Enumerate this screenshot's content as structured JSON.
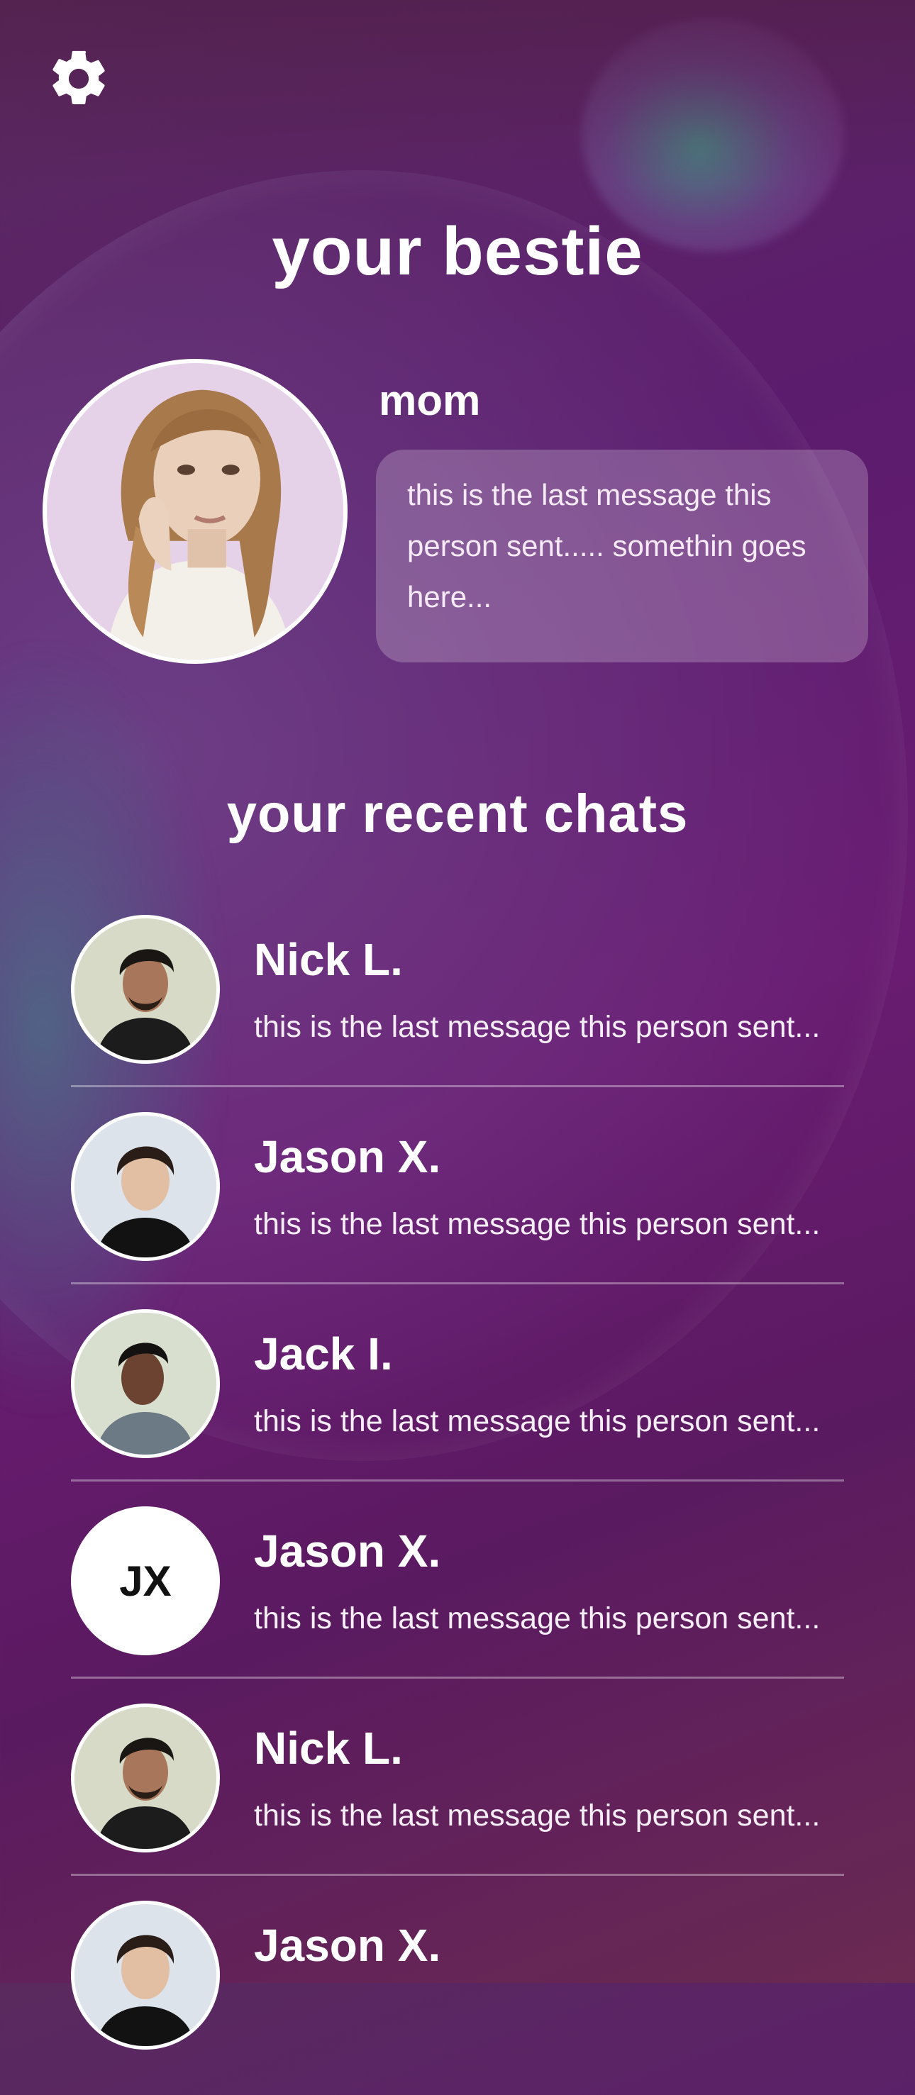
{
  "header": {
    "settings_icon": "gear-icon"
  },
  "bestie": {
    "section_title": "your bestie",
    "name": "mom",
    "last_message": "this is the last message this person sent..... somethin goes here..."
  },
  "recent": {
    "section_title": "your recent chats",
    "chats": [
      {
        "name": "Nick L.",
        "preview": "this is the last message this person sent...",
        "avatar": "photo"
      },
      {
        "name": "Jason X.",
        "preview": "this is the last message this person sent...",
        "avatar": "photo"
      },
      {
        "name": "Jack I.",
        "preview": "this is the last message this person sent...",
        "avatar": "photo"
      },
      {
        "name": "Jason X.",
        "preview": "this is the last message this person sent...",
        "avatar": "initials",
        "initials": "JX"
      },
      {
        "name": "Nick L.",
        "preview": "this is the last message this person sent...",
        "avatar": "photo"
      },
      {
        "name": "Jason X.",
        "preview": "",
        "avatar": "photo"
      }
    ]
  },
  "colors": {
    "background_top": "#5a2a5e",
    "background_mid": "#6a1c72",
    "bubble_fill": "rgba(255,255,255,0.22)",
    "text": "#ffffff"
  }
}
